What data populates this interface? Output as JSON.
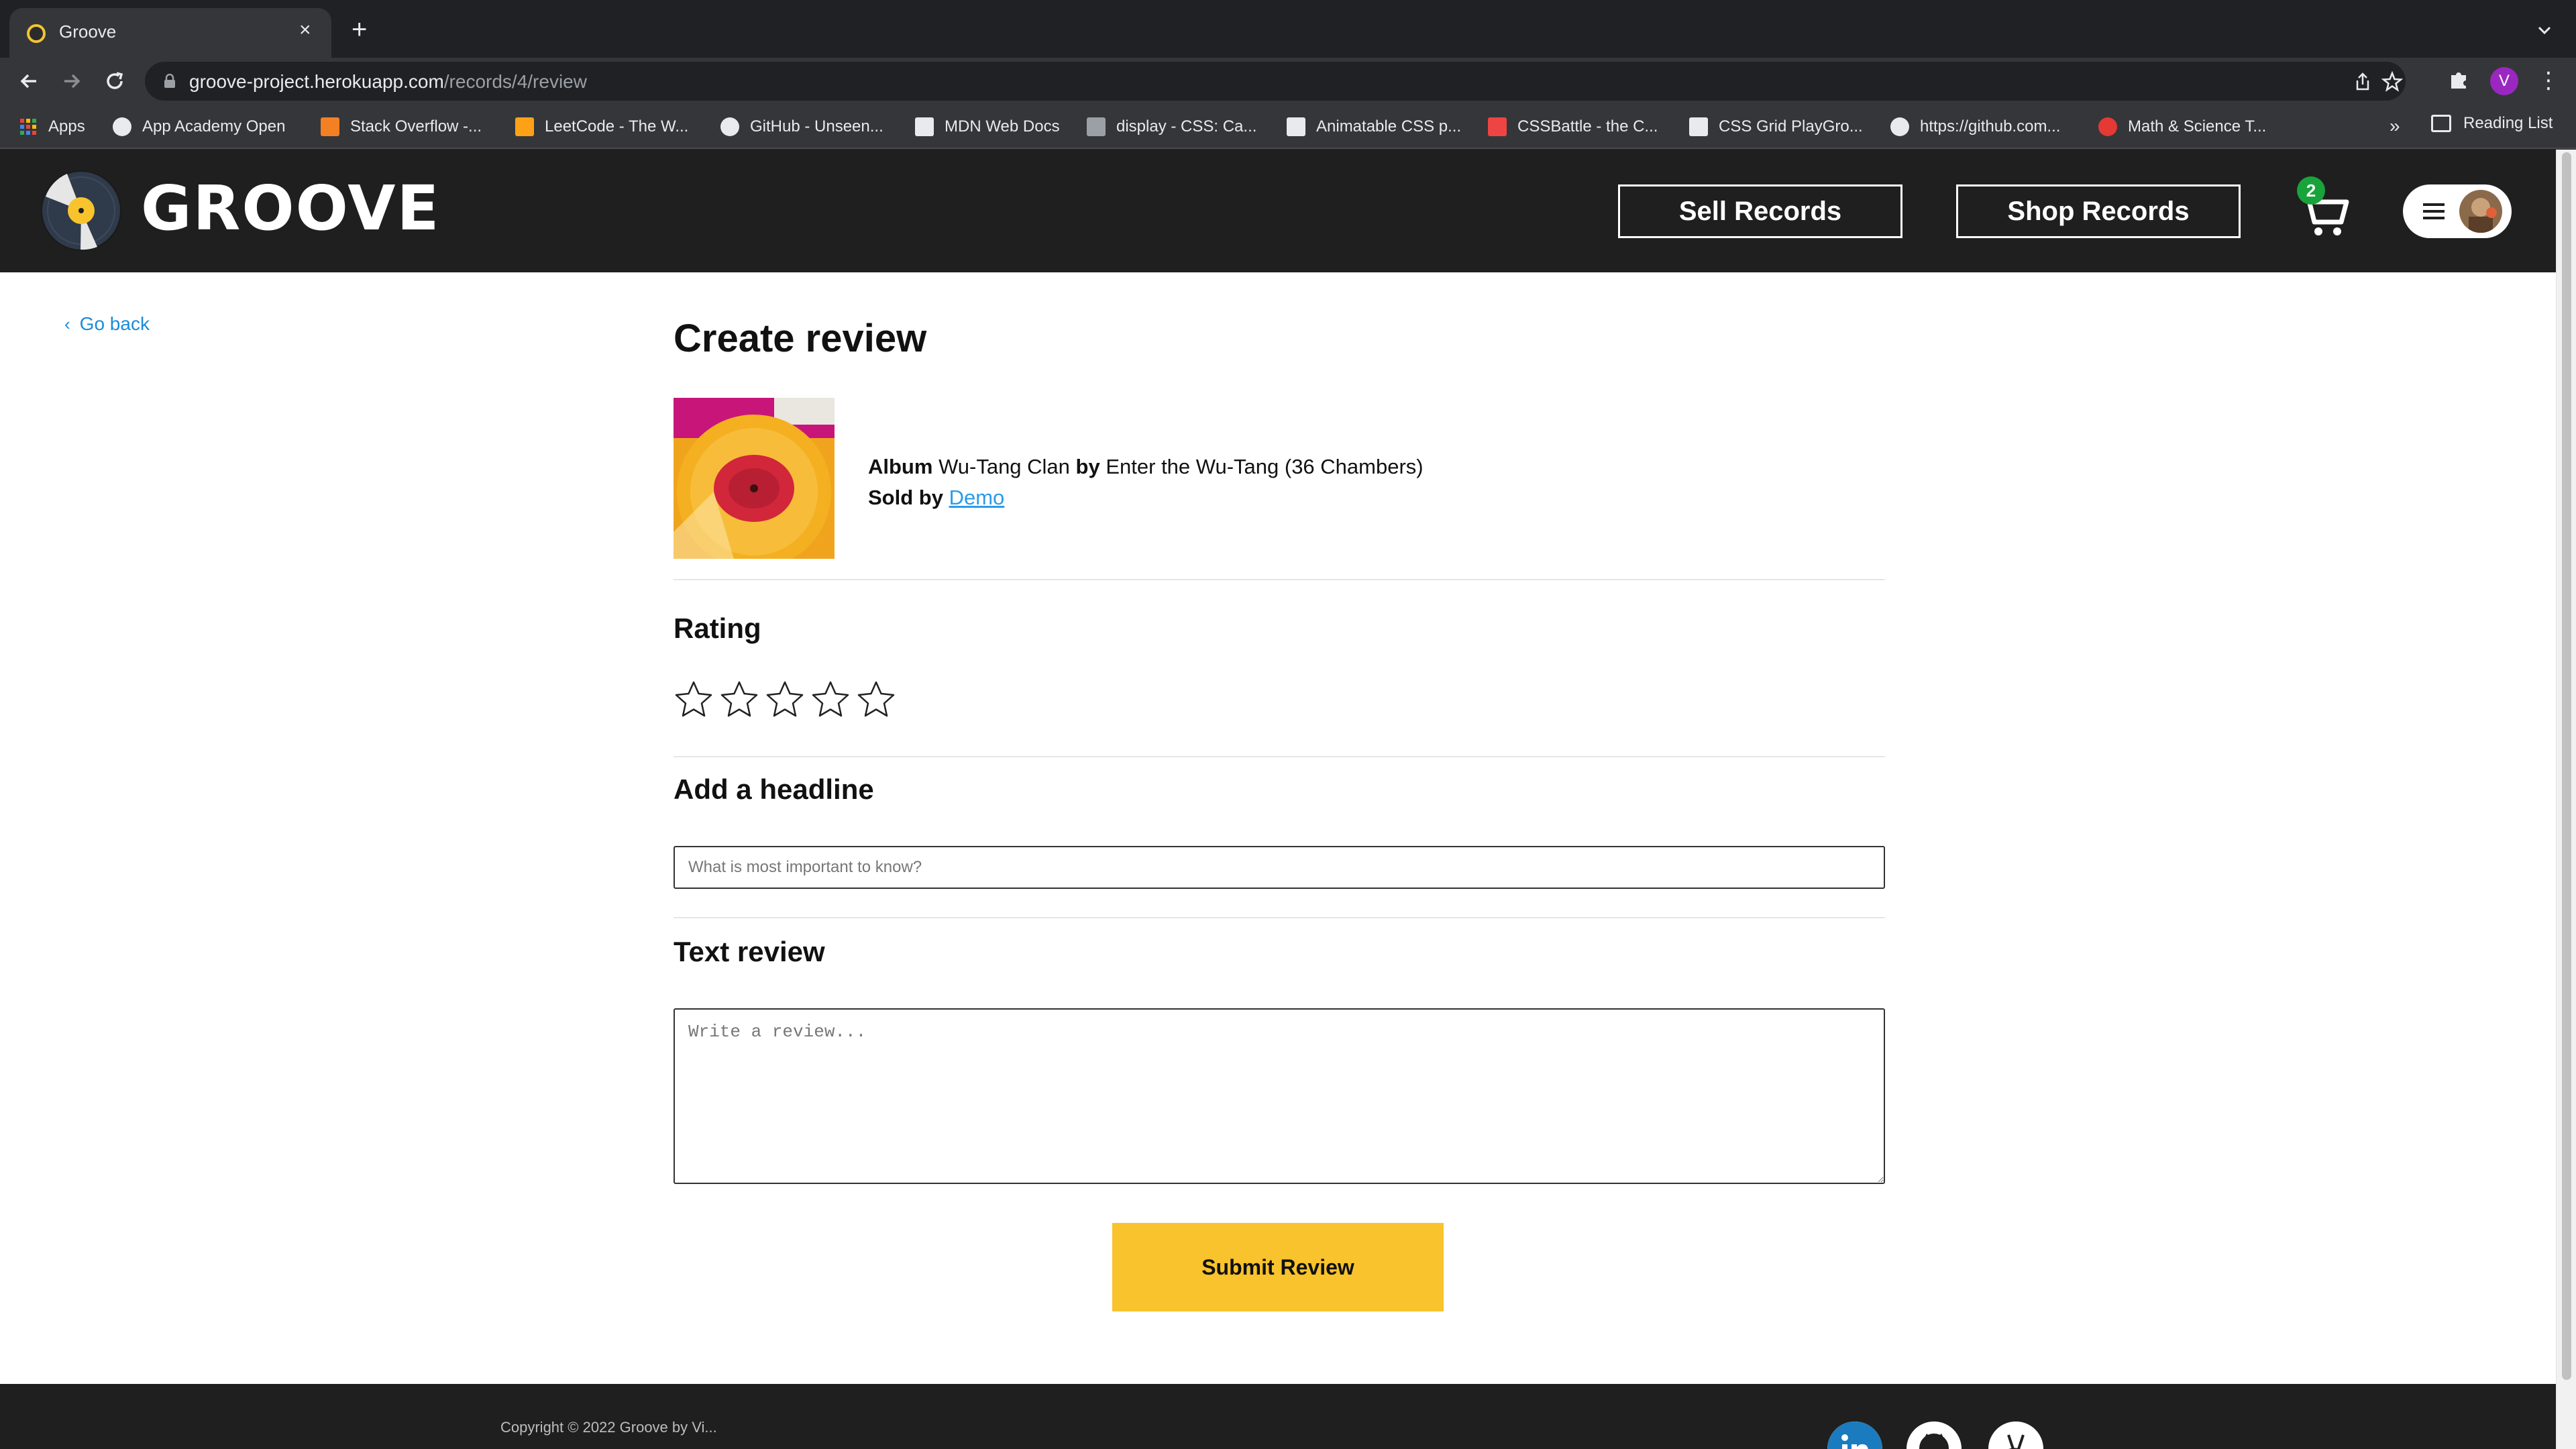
{
  "browser": {
    "tab_title": "Groove",
    "new_tab": "+",
    "close_tab": "×",
    "url_host": "groove-project.herokuapp.com",
    "url_path": "/records/4/review",
    "profile_initial": "V",
    "bookmarks": [
      {
        "label": "Apps",
        "color": "#e8453c"
      },
      {
        "label": "App Academy Open",
        "color": "#e8eaed"
      },
      {
        "label": "Stack Overflow -...",
        "color": "#f48024"
      },
      {
        "label": "LeetCode - The W...",
        "color": "#ffa116"
      },
      {
        "label": "GitHub - Unseen...",
        "color": "#e8eaed"
      },
      {
        "label": "MDN Web Docs",
        "color": "#e8eaed"
      },
      {
        "label": "display - CSS: Ca...",
        "color": "#e8eaed"
      },
      {
        "label": "Animatable CSS p...",
        "color": "#e8eaed"
      },
      {
        "label": "CSSBattle - the C...",
        "color": "#ef4444"
      },
      {
        "label": "CSS Grid PlayGro...",
        "color": "#e8eaed"
      },
      {
        "label": "https://github.com...",
        "color": "#e8eaed"
      },
      {
        "label": "Math & Science T...",
        "color": "#e53935"
      }
    ],
    "more": "»",
    "reading_list": "Reading List"
  },
  "header": {
    "logo": "GROOVE",
    "sell_button": "Sell Records",
    "shop_button": "Shop Records",
    "cart_count": "2"
  },
  "nav": {
    "go_back": "Go back"
  },
  "review": {
    "title": "Create review",
    "album_label": "Album",
    "artist": "Wu-Tang Clan",
    "by_label": "by",
    "album_name": "Enter the Wu-Tang (36 Chambers)",
    "sold_by_label": "Sold by",
    "seller": "Demo",
    "rating_heading": "Rating",
    "rating_value": 0,
    "rating_max": 5,
    "headline_heading": "Add a headline",
    "headline_placeholder": "What is most important to know?",
    "headline_value": "",
    "text_heading": "Text review",
    "text_placeholder": "Write a review...",
    "text_value": "",
    "submit": "Submit Review"
  },
  "footer": {
    "copyright": "Copyright © 2022 Groove by Vi..."
  },
  "colors": {
    "header_bg": "#1f1f1f",
    "accent_yellow": "#f8c32c",
    "link_blue": "#2b9be8",
    "badge_green": "#18a33b"
  }
}
